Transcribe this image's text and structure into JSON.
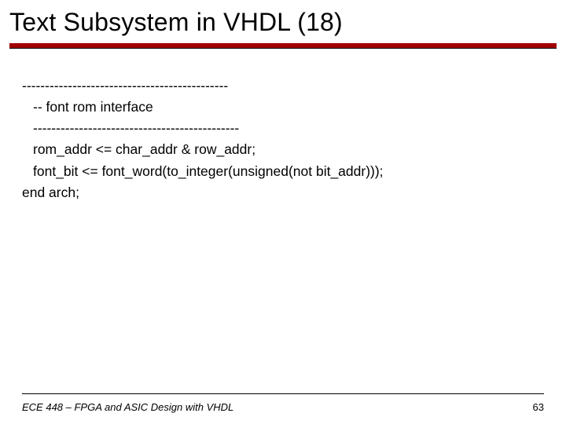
{
  "title": "Text Subsystem in VHDL (18)",
  "code": {
    "sep1": "---------------------------------------------",
    "comment": "-- font rom interface",
    "sep2": "---------------------------------------------",
    "line1": "rom_addr <= char_addr & row_addr;",
    "line2": "font_bit <= font_word(to_integer(unsigned(not bit_addr)));",
    "line3": "end arch;"
  },
  "footer": "ECE 448 – FPGA and ASIC Design with VHDL",
  "page_number": "63"
}
